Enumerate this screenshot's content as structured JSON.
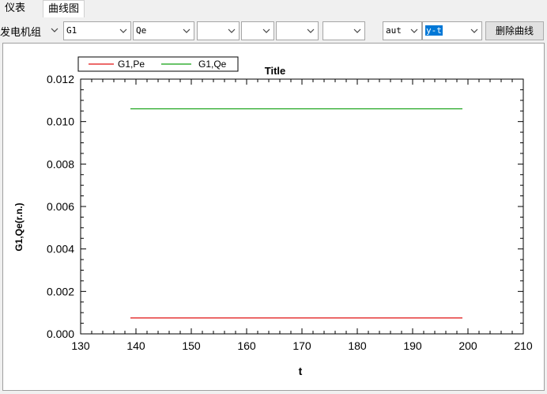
{
  "tabs": [
    {
      "label": "仪表",
      "active": false
    },
    {
      "label": "曲线图",
      "active": true
    }
  ],
  "toolbar": {
    "generator_label": "发电机组",
    "generator_value": "G1",
    "quantity_value": "Qe",
    "empty_combos": [
      "",
      "",
      "",
      "",
      ""
    ],
    "axis_mode_value": "aut",
    "plot_mode_value": "y-t",
    "delete_button": "删除曲线"
  },
  "colors": {
    "series_pe": "#e01010",
    "series_qe": "#10a010",
    "selection": "#0078d7"
  },
  "chart_data": {
    "type": "line",
    "title": "Title",
    "xlabel": "t",
    "ylabel": "G1,Qe(r.n.)",
    "xlim": [
      130,
      210
    ],
    "ylim": [
      0.0,
      0.012
    ],
    "xticks": [
      130,
      140,
      150,
      160,
      170,
      180,
      190,
      200,
      210
    ],
    "yticks": [
      "0.000",
      "0.002",
      "0.004",
      "0.006",
      "0.008",
      "0.010",
      "0.012"
    ],
    "legend_position": "top-left",
    "series": [
      {
        "name": "G1,Pe",
        "color": "#e01010",
        "x": [
          139,
          199
        ],
        "y": [
          0.00075,
          0.00075
        ]
      },
      {
        "name": "G1,Qe",
        "color": "#10a010",
        "x": [
          139,
          199
        ],
        "y": [
          0.0106,
          0.0106
        ]
      }
    ]
  }
}
